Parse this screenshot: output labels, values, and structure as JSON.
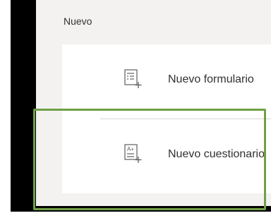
{
  "section": {
    "title": "Nuevo"
  },
  "items": [
    {
      "label": "Nuevo formulario",
      "icon": "new-form-icon"
    },
    {
      "label": "Nuevo cuestionario",
      "icon": "new-quiz-icon",
      "icon_text": "A+"
    }
  ],
  "colors": {
    "highlight": "#70a045",
    "panel": "#f3f2f1",
    "card": "#ffffff",
    "text": "#323130"
  }
}
